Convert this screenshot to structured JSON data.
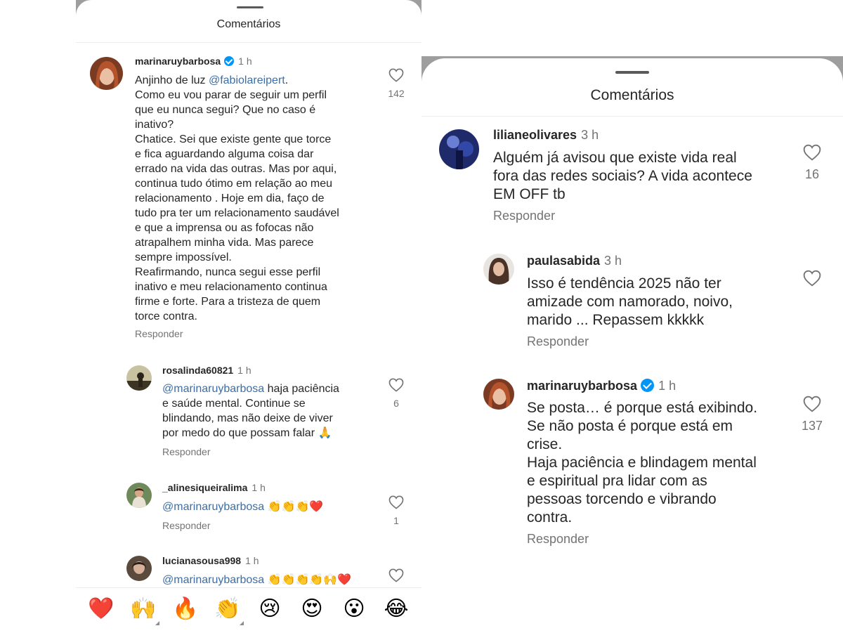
{
  "left": {
    "title": "Comentários",
    "comments": [
      {
        "username": "marinaruybarbosa",
        "verified": true,
        "time": "1 h",
        "mention": "",
        "text_prefix": "Anjinho de luz ",
        "text_mention": "@fabiolareipert",
        "text_body": ".\nComo eu vou parar de seguir um perfil\nque eu nunca segui? Que no caso é\ninativo?\nChatice. Sei que existe gente que torce\ne fica aguardando alguma coisa dar\nerrado na vida das outras. Mas por aqui,\ncontinua tudo ótimo em relação ao meu\nrelacionamento . Hoje em dia, faço de\ntudo pra ter um relacionamento saudável\ne que a imprensa ou as fofocas não\natrapalhem minha vida. Mas parece\nsempre impossível.\nReafirmando, nunca segui esse perfil\ninativo e meu relacionamento continua\nfirme e forte. Para a tristeza de quem\ntorce contra.",
        "reply": "Responder",
        "likes": "142"
      },
      {
        "username": "rosalinda60821",
        "time": "1 h",
        "text_mention": "@marinaruybarbosa",
        "text_body": " haja paciência\ne saúde mental. Continue se\nblindando, mas não deixe de viver\npor medo do que possam falar 🙏",
        "reply": "Responder",
        "likes": "6"
      },
      {
        "username": "_alinesiqueiralima",
        "time": "1 h",
        "text_mention": "@marinaruybarbosa",
        "text_body": " 👏👏👏❤️",
        "reply": "Responder",
        "likes": "1"
      },
      {
        "username": "lucianasousa998",
        "time": "1 h",
        "text_mention": "@marinaruybarbosa",
        "text_body": " 👏👏👏👏🙌❤️",
        "reply": "",
        "likes": ""
      }
    ],
    "emojis": [
      "❤️",
      "🙌",
      "🔥",
      "👏",
      "😢",
      "😍",
      "😮",
      "😂"
    ]
  },
  "right": {
    "title": "Comentários",
    "comments": [
      {
        "username": "lilianeolivares",
        "time": "3 h",
        "text": "Alguém já avisou que existe vida real\nfora das redes  sociais? A vida acontece\nEM OFF tb",
        "reply": "Responder",
        "likes": "16"
      },
      {
        "username": "paulasabida",
        "time": "3 h",
        "text": "Isso é tendência 2025 não ter\namizade com namorado, noivo,\nmarido ... Repassem kkkkk",
        "reply": "Responder",
        "likes": ""
      },
      {
        "username": "marinaruybarbosa",
        "verified": true,
        "time": "1 h",
        "text": "Se posta… é porque está exibindo.\nSe não posta é porque está em\ncrise.\nHaja paciência e blindagem mental\ne espiritual pra lidar com as\npessoas torcendo e vibrando\ncontra.",
        "reply": "Responder",
        "likes": "137"
      }
    ]
  },
  "icons": {
    "like": "heart-outline-icon",
    "verified": "verified-badge-icon"
  },
  "colors": {
    "verified": "#0095f6",
    "mention": "#3b6ea8",
    "muted": "#737373",
    "sheet_backdrop": "#9e9e9e"
  }
}
